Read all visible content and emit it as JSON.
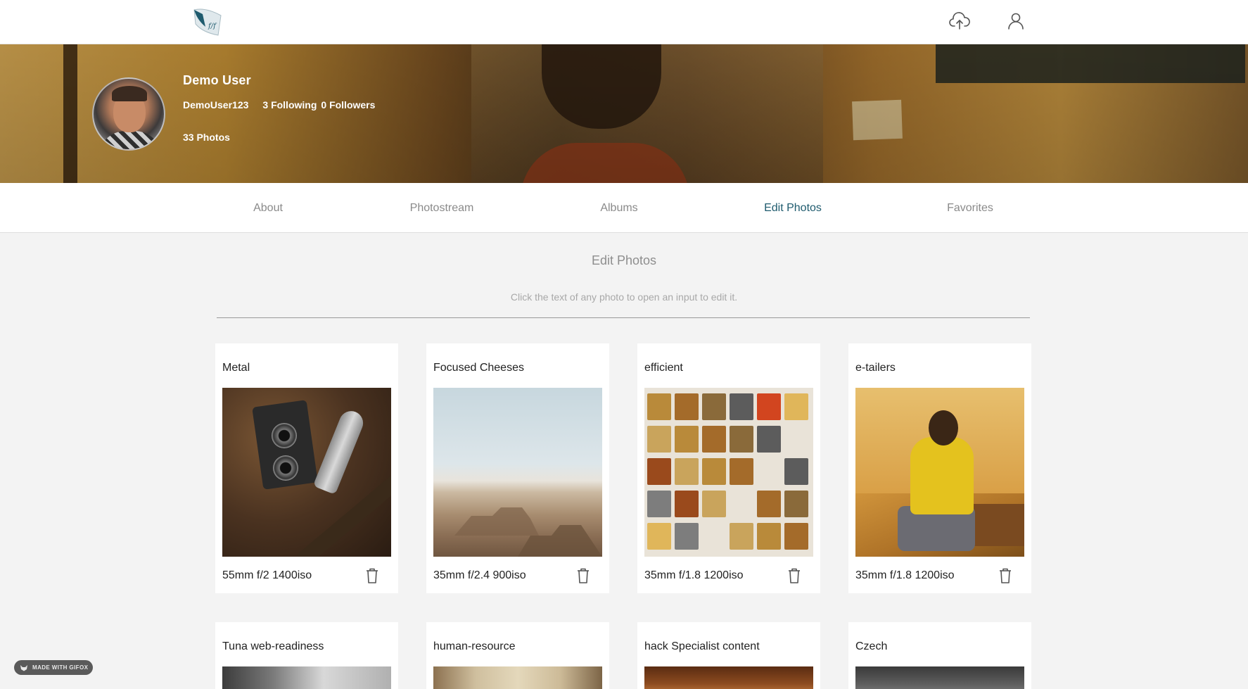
{
  "header": {
    "logo_text": "f/f",
    "upload_icon": "cloud-upload-icon",
    "profile_icon": "user-icon"
  },
  "profile": {
    "name": "Demo User",
    "username": "DemoUser123",
    "following": "3 Following",
    "followers": "0 Followers",
    "photos": "33 Photos"
  },
  "tabs": [
    {
      "label": "About"
    },
    {
      "label": "Photostream"
    },
    {
      "label": "Albums"
    },
    {
      "label": "Edit Photos",
      "active": true
    },
    {
      "label": "Favorites"
    }
  ],
  "section": {
    "title": "Edit Photos",
    "subtitle": "Click the text of any photo to open an input to edit it."
  },
  "photos": [
    {
      "title": "Metal",
      "settings": "55mm f/2 1400iso"
    },
    {
      "title": "Focused Cheeses",
      "settings": "35mm f/2.4 900iso"
    },
    {
      "title": "efficient",
      "settings": "35mm f/1.8 1200iso"
    },
    {
      "title": "e-tailers",
      "settings": "35mm f/1.8 1200iso"
    },
    {
      "title": "Tuna web-readiness"
    },
    {
      "title": "human-resource"
    },
    {
      "title": "hack Specialist content"
    },
    {
      "title": "Czech"
    }
  ],
  "badge": {
    "label": "MADE WITH GIFOX"
  },
  "colors": {
    "accent": "#1f5b6e",
    "tab_inactive": "#8a8a8a",
    "background": "#f3f3f3"
  }
}
